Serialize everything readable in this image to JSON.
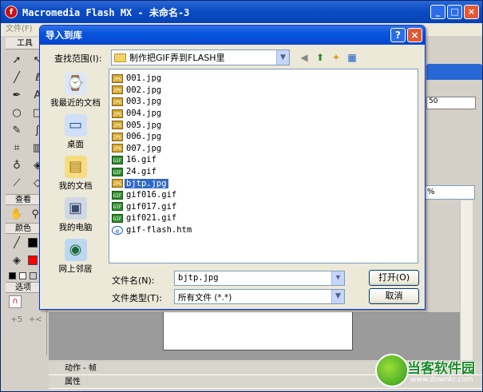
{
  "flash": {
    "title": "Macromedia Flash MX - 未命名-3",
    "menu_first": "文件(F)",
    "tools_header": "工具",
    "view_section": "查看",
    "colors_section": "颜色",
    "options_section": "选项",
    "zoom_value": "%",
    "ruler_value": "50",
    "panel_actions": "动作 - 帧",
    "panel_properties": "属性"
  },
  "dialog": {
    "title": "导入到库",
    "help_icon": "?",
    "close_icon": "×",
    "lookin_label": "查找范围(I):",
    "lookin_value": "制作把GIF弄到FLASH里",
    "places": [
      {
        "label": "我最近的文档",
        "icon": "recent-documents-icon"
      },
      {
        "label": "桌面",
        "icon": "desktop-icon"
      },
      {
        "label": "我的文档",
        "icon": "my-documents-icon"
      },
      {
        "label": "我的电脑",
        "icon": "my-computer-icon"
      },
      {
        "label": "网上邻居",
        "icon": "network-places-icon"
      }
    ],
    "files": [
      {
        "name": "001.jpg",
        "type": "jpg",
        "badge": "JPG"
      },
      {
        "name": "002.jpg",
        "type": "jpg",
        "badge": "JPG"
      },
      {
        "name": "003.jpg",
        "type": "jpg",
        "badge": "JPG"
      },
      {
        "name": "004.jpg",
        "type": "jpg",
        "badge": "JPG"
      },
      {
        "name": "005.jpg",
        "type": "jpg",
        "badge": "JPG"
      },
      {
        "name": "006.jpg",
        "type": "jpg",
        "badge": "JPG"
      },
      {
        "name": "007.jpg",
        "type": "jpg",
        "badge": "JPG"
      },
      {
        "name": "16.gif",
        "type": "gif",
        "badge": "GIF"
      },
      {
        "name": "24.gif",
        "type": "gif",
        "badge": "GIF"
      },
      {
        "name": "bjtp.jpg",
        "type": "jpg",
        "badge": "JPG",
        "selected": true
      },
      {
        "name": "gif016.gif",
        "type": "gif",
        "badge": "GIF"
      },
      {
        "name": "gif017.gif",
        "type": "gif",
        "badge": "GIF"
      },
      {
        "name": "gif021.gif",
        "type": "gif",
        "badge": "GIF"
      },
      {
        "name": "gif-flash.htm",
        "type": "htm",
        "badge": "e"
      }
    ],
    "filename_label": "文件名(N):",
    "filename_value": "bjtp.jpg",
    "filetype_label": "文件类型(T):",
    "filetype_value": "所有文件 (*.*)",
    "open_button": "打开(O)",
    "cancel_button": "取消"
  },
  "watermark": {
    "name": "当客软件园",
    "url": "www.downkr.com"
  }
}
